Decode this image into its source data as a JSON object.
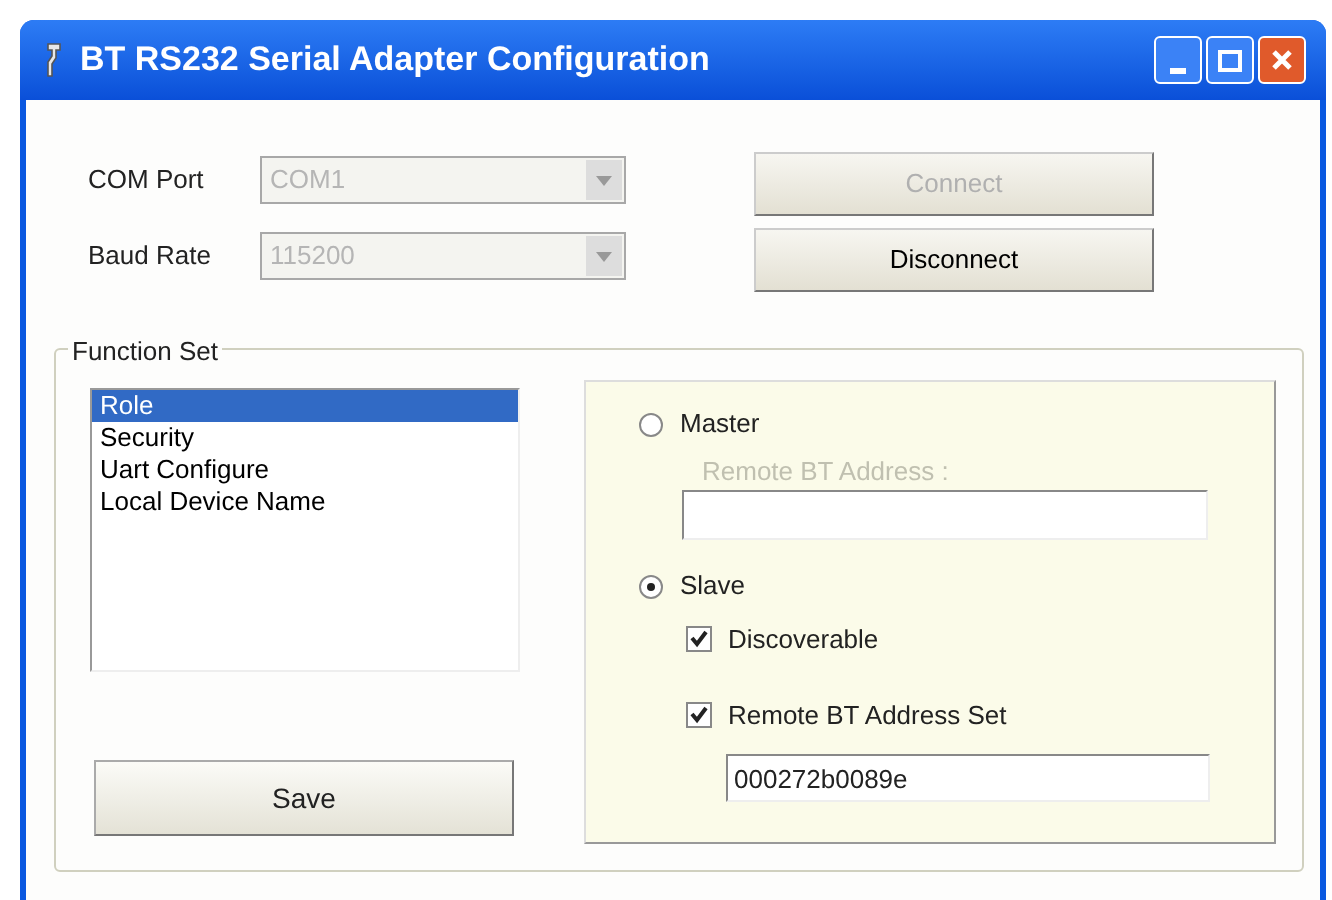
{
  "window": {
    "title": "BT RS232 Serial Adapter Configuration"
  },
  "com_port": {
    "label": "COM Port",
    "value": "COM1",
    "disabled": true
  },
  "baud_rate": {
    "label": "Baud Rate",
    "value": "115200",
    "disabled": true
  },
  "buttons": [
    {
      "label": "Connect",
      "disabled": true
    },
    {
      "label": "Disconnect",
      "disabled": false
    }
  ],
  "function_set": {
    "title": "Function Set",
    "items": [
      {
        "label": "Role",
        "selected": true
      },
      {
        "label": "Security",
        "selected": false
      },
      {
        "label": "Uart Configure",
        "selected": false
      },
      {
        "label": "Local Device Name",
        "selected": false
      }
    ],
    "save_button": "Save"
  },
  "role": {
    "master": {
      "label": "Master",
      "selected": false
    },
    "remote_address_label": {
      "text": "Remote BT Address :",
      "disabled": true
    },
    "slave": {
      "label": "Slave",
      "selected": true
    },
    "discoverable": {
      "label": "Discoverable",
      "checked": true
    },
    "remote_address_set": {
      "label": "Remote BT Address Set",
      "checked": true
    },
    "remote_address": {
      "value": "000272b0089e"
    }
  }
}
